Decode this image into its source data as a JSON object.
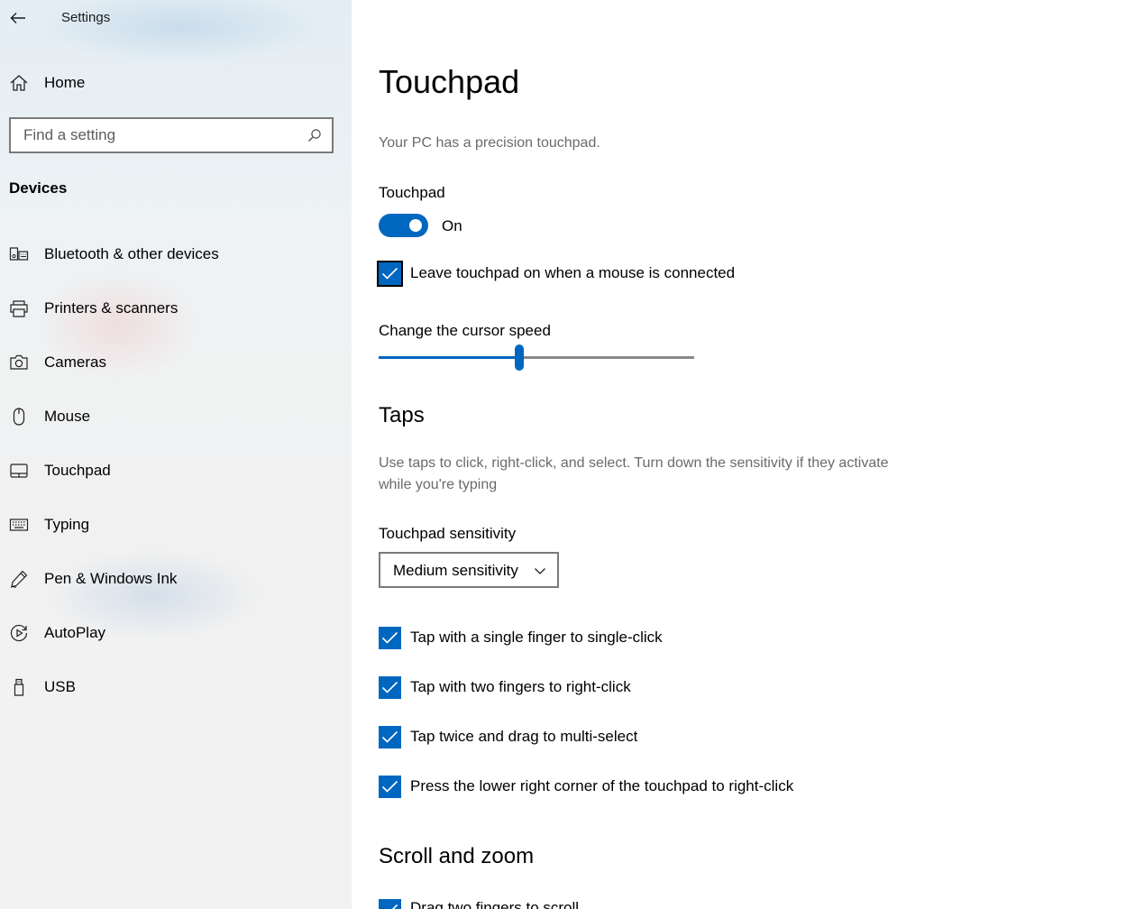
{
  "window": {
    "app_title": "Settings"
  },
  "sidebar": {
    "home_label": "Home",
    "search": {
      "placeholder": "Find a setting",
      "value": ""
    },
    "section_heading": "Devices",
    "items": [
      {
        "label": "Bluetooth & other devices",
        "icon": "bluetooth-devices-icon"
      },
      {
        "label": "Printers & scanners",
        "icon": "printer-icon"
      },
      {
        "label": "Cameras",
        "icon": "camera-icon"
      },
      {
        "label": "Mouse",
        "icon": "mouse-icon"
      },
      {
        "label": "Touchpad",
        "icon": "touchpad-icon"
      },
      {
        "label": "Typing",
        "icon": "keyboard-icon"
      },
      {
        "label": "Pen & Windows Ink",
        "icon": "pen-icon"
      },
      {
        "label": "AutoPlay",
        "icon": "autoplay-icon"
      },
      {
        "label": "USB",
        "icon": "usb-icon"
      }
    ]
  },
  "main": {
    "title": "Touchpad",
    "precision_text": "Your PC has a precision touchpad.",
    "touchpad_toggle": {
      "label": "Touchpad",
      "state_text": "On",
      "on": true
    },
    "leave_on_checkbox": {
      "label": "Leave touchpad on when a mouse is connected",
      "checked": true
    },
    "cursor_speed": {
      "label": "Change the cursor speed",
      "value_fraction": 0.445
    },
    "taps": {
      "title": "Taps",
      "description": "Use taps to click, right-click, and select. Turn down the sensitivity if they activate while you're typing",
      "sensitivity_label": "Touchpad sensitivity",
      "sensitivity_value": "Medium sensitivity",
      "checkboxes": [
        {
          "label": "Tap with a single finger to single-click",
          "checked": true
        },
        {
          "label": "Tap with two fingers to right-click",
          "checked": true
        },
        {
          "label": "Tap twice and drag to multi-select",
          "checked": true
        },
        {
          "label": "Press the lower right corner of the touchpad to right-click",
          "checked": true
        }
      ]
    },
    "scroll_zoom": {
      "title": "Scroll and zoom",
      "first_checkbox": {
        "label": "Drag two fingers to scroll",
        "checked": true
      }
    }
  },
  "colors": {
    "accent": "#0067c0",
    "secondary_text": "#6b6b6b",
    "border": "#7a7a7a"
  }
}
